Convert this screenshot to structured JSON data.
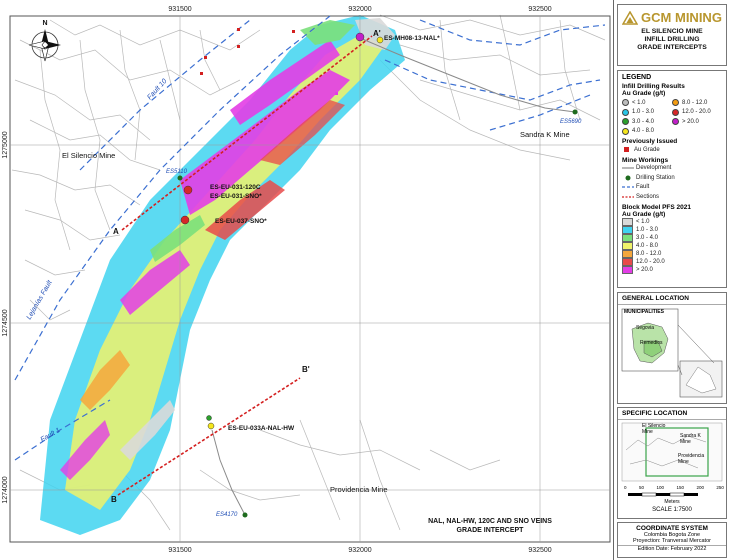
{
  "map": {
    "grid_x_labels": [
      "931500",
      "932000",
      "932500"
    ],
    "grid_y_labels": [
      "1275000",
      "1274500",
      "1274000"
    ],
    "north_label": "N",
    "faults": [
      "Fault 10",
      "Lejanías Fault",
      "Fault 1"
    ],
    "mines": [
      "El Silencio Mine",
      "Sandra K Mine",
      "Providencia Mine"
    ],
    "stations": [
      "ES5690",
      "ES5110",
      "ES4170"
    ],
    "sections": {
      "a": "A",
      "a_prime": "A'",
      "b": "B",
      "b_prime": "B'"
    },
    "drillholes": [
      "ES-MH08-13-NAL*",
      "ES-EU-031-120C",
      "ES-EU-031-SNO*",
      "ES-EU-037-SNO*",
      "ES-EU-033A-NAL-HW"
    ],
    "caption_line1": "NAL, NAL-HW, 120C AND SNO VEINS",
    "caption_line2": "GRADE INTERCEPT"
  },
  "panel": {
    "brand": "GCM MINING",
    "title_lines": [
      "EL SILENCIO MINE",
      "INFILL DRILLING",
      "GRADE INTERCEPTS"
    ],
    "legend": {
      "heading": "LEGEND",
      "infill_heading": "Infill Drilling Results",
      "au_grade_label": "Au Grade (g/t)",
      "infill_items": [
        {
          "label": "< 1.0",
          "color": "#bdbdbd"
        },
        {
          "label": "8.0 - 12.0",
          "color": "#f39c12"
        },
        {
          "label": "1.0 - 3.0",
          "color": "#29c5e6"
        },
        {
          "label": "12.0 - 20.0",
          "color": "#d62728"
        },
        {
          "label": "3.0 - 4.0",
          "color": "#2ca02c"
        },
        {
          "label": "> 20.0",
          "color": "#c21fc9"
        },
        {
          "label": "4.0 - 8.0",
          "color": "#f5e61c"
        }
      ],
      "prev_heading": "Previously Issued",
      "prev_item": "Au Grade",
      "workings_heading": "Mine Workings",
      "workings_items": [
        "Development",
        "Drilling Station",
        "Fault",
        "Sections"
      ],
      "block_heading": "Block Model PFS 2021",
      "block_items": [
        {
          "label": "< 1.0",
          "color": "#d9d9d9"
        },
        {
          "label": "1.0 - 3.0",
          "color": "#3fd3f0"
        },
        {
          "label": "3.0 - 4.0",
          "color": "#7be07b"
        },
        {
          "label": "4.0 - 8.0",
          "color": "#f0f26a"
        },
        {
          "label": "8.0 - 12.0",
          "color": "#f4a73c"
        },
        {
          "label": "12.0 - 20.0",
          "color": "#e84a4a"
        },
        {
          "label": "> 20.0",
          "color": "#e33de6"
        }
      ]
    },
    "general_location": {
      "heading": "GENERAL LOCATION",
      "municipalities": "MUNICIPALITIES",
      "segovia": "Segovia",
      "remedios": "Remedios"
    },
    "specific_location": {
      "heading": "SPECIFIC LOCATION",
      "el_silencio": "El Silencio Mine",
      "sandra": "Sandra K Mine",
      "providencia": "Providencia Mine",
      "scale_ticks": [
        "0",
        "50",
        "100",
        "150",
        "200",
        "250"
      ],
      "meters": "Meters",
      "scale": "SCALE 1:7500"
    },
    "coords": {
      "heading": "COORDINATE SYSTEM",
      "line1": "Colombia Bogota Zone",
      "line2": "Proyection: Tranversal Mercator",
      "edition": "Edition Date: February 2022"
    }
  }
}
